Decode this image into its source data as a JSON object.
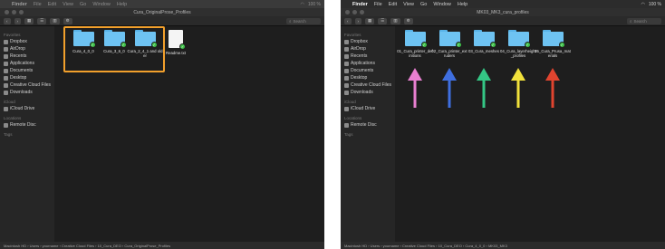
{
  "left": {
    "menubar": {
      "apple": "",
      "app": "Finder",
      "menus": [
        "File",
        "Edit",
        "View",
        "Go",
        "Window",
        "Help"
      ],
      "right": [
        "100 %"
      ]
    },
    "window_title": "Cura_OriginalProse_Profiles",
    "search_placeholder": "Search",
    "sidebar": {
      "favorites_header": "Favorites",
      "favorites": [
        "Dropbox",
        "AirDrop",
        "Recents",
        "Applications",
        "Documents",
        "Desktop",
        "Creative Cloud Files",
        "Downloads"
      ],
      "icloud_header": "iCloud",
      "icloud": [
        "iCloud Drive"
      ],
      "locations_header": "Locations",
      "locations": [
        "Remote Disc"
      ],
      "tags_header": "Tags"
    },
    "items": [
      {
        "name": "Cura_4_0_0",
        "kind": "folder"
      },
      {
        "name": "Cura_3_6_0",
        "kind": "folder"
      },
      {
        "name": "Cura_2_4_1 and older",
        "kind": "folder"
      },
      {
        "name": "Readme.txt",
        "kind": "document"
      }
    ],
    "pathbar": "Macintosh HD › Users › yourname › Creative Cloud Files › 10_Cura_DEO › Cura_OriginalProse_Profiles",
    "highlight_color": "#f2a02c"
  },
  "right": {
    "menubar": {
      "apple": "",
      "app": "Finder",
      "menus": [
        "File",
        "Edit",
        "View",
        "Go",
        "Window",
        "Help"
      ],
      "right": [
        "100 %"
      ]
    },
    "window_title": "MK03_MK3_cura_profiles",
    "search_placeholder": "Search",
    "sidebar": {
      "favorites_header": "Favorites",
      "favorites": [
        "Dropbox",
        "AirDrop",
        "Recents",
        "Applications",
        "Documents",
        "Desktop",
        "Creative Cloud Files",
        "Downloads"
      ],
      "icloud_header": "iCloud",
      "icloud": [
        "iCloud Drive"
      ],
      "locations_header": "Locations",
      "locations": [
        "Remote Disc"
      ],
      "tags_header": "Tags"
    },
    "items": [
      {
        "name": "01_Cura_printer_definitions",
        "kind": "folder",
        "arrow_color": "#e87fd0"
      },
      {
        "name": "02_Cura_printer_extruders",
        "kind": "folder",
        "arrow_color": "#3f6fe0"
      },
      {
        "name": "03_Cura_meshes",
        "kind": "folder",
        "arrow_color": "#34c785"
      },
      {
        "name": "04_Cura_layerheight_profiles",
        "kind": "folder",
        "arrow_color": "#f1e13b"
      },
      {
        "name": "05_Cura_Prusa_materials",
        "kind": "folder",
        "arrow_color": "#e0442f"
      }
    ],
    "pathbar": "Macintosh HD › Users › yourname › Creative Cloud Files › 10_Cura_DEO › Cura_4_0_0 › MK03_MK3"
  }
}
